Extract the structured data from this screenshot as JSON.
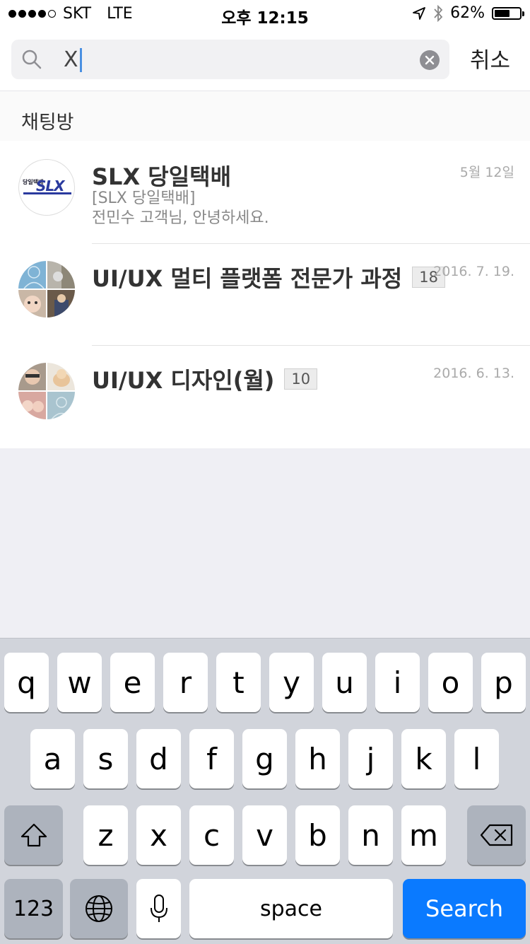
{
  "status_bar": {
    "carrier": "SKT",
    "network": "LTE",
    "time": "오후 12:15",
    "battery_percent": "62%",
    "battery_level": 0.62
  },
  "search": {
    "query": "X",
    "cancel_label": "취소"
  },
  "section_title": "채팅방",
  "chats": [
    {
      "title": "SLX 당일택배",
      "date": "5월 12일",
      "preview_line1": "[SLX 당일택배]",
      "preview_line2": "전민수 고객님, 안녕하세요.",
      "avatar_logo_small": "당일택배",
      "avatar_logo_main": "SLX"
    },
    {
      "title": "UI/UX 멀티 플랫폼 전문가 과정",
      "count": "18",
      "date": "2016. 7. 19."
    },
    {
      "title": "UI/UX 디자인(월)",
      "count": "10",
      "date": "2016. 6. 13."
    }
  ],
  "keyboard": {
    "row1": [
      "q",
      "w",
      "e",
      "r",
      "t",
      "y",
      "u",
      "i",
      "o",
      "p"
    ],
    "row2": [
      "a",
      "s",
      "d",
      "f",
      "g",
      "h",
      "j",
      "k",
      "l"
    ],
    "row3": [
      "z",
      "x",
      "c",
      "v",
      "b",
      "n",
      "m"
    ],
    "numbers_label": "123",
    "space_label": "space",
    "search_label": "Search"
  },
  "colors": {
    "accent": "#0a7aff",
    "background": "#efeff4"
  }
}
